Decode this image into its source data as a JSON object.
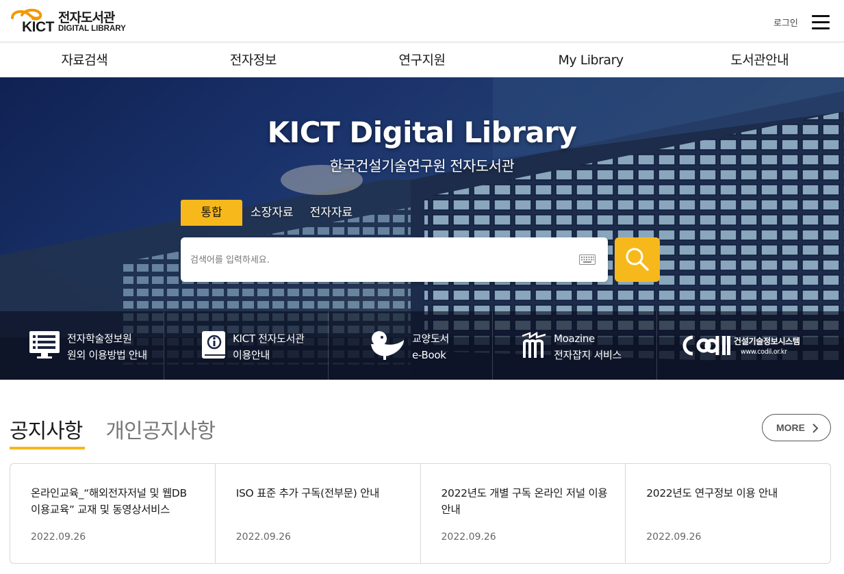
{
  "header": {
    "logo_mark": "KICT",
    "logo_ko": "전자도서관",
    "logo_en": "DIGITAL LIBRARY",
    "login_label": "로그인"
  },
  "nav": [
    {
      "label": "자료검색"
    },
    {
      "label": "전자정보"
    },
    {
      "label": "연구지원"
    },
    {
      "label": "My Library"
    },
    {
      "label": "도서관안내"
    }
  ],
  "hero": {
    "title": "KICT Digital Library",
    "subtitle": "한국건설기술연구원 전자도서관",
    "tabs": [
      {
        "label": "통합"
      },
      {
        "label": "소장자료"
      },
      {
        "label": "전자자료"
      }
    ],
    "search_placeholder": "검색어를 입력하세요."
  },
  "quick_links": [
    {
      "line1": "전자학술정보원",
      "line2": "원외 이용방법 안내",
      "icon": "monitor-list-icon"
    },
    {
      "line1": "KICT 전자도서관",
      "line2": "이용안내",
      "icon": "info-book-icon"
    },
    {
      "line1": "교양도서",
      "line2": "e-Book",
      "icon": "bird-icon"
    },
    {
      "line1": "Moazine",
      "line2": "전자잡지 서비스",
      "icon": "moazine-icon"
    },
    {
      "brand": "cdil",
      "line1": "건설기술정보시스템",
      "line2": "www.codil.or.kr",
      "icon": "codil-logo"
    }
  ],
  "notices": {
    "tabs": [
      {
        "label": "공지사항"
      },
      {
        "label": "개인공지사항"
      }
    ],
    "more_label": "MORE",
    "items": [
      {
        "title": "온라인교육_“해외전자저널 및 웹DB 이용교육” 교재 및 동영상서비스",
        "date": "2022.09.26"
      },
      {
        "title": "ISO 표준 추가 구독(전부문) 안내",
        "date": "2022.09.26"
      },
      {
        "title": "2022년도 개별 구독 온라인 저널 이용 안내",
        "date": "2022.09.26"
      },
      {
        "title": "2022년도 연구정보 이용 안내",
        "date": "2022.09.26"
      }
    ]
  },
  "colors": {
    "accent": "#f7b81b",
    "logo_orange": "#f39800",
    "text": "#1a1a1a"
  }
}
